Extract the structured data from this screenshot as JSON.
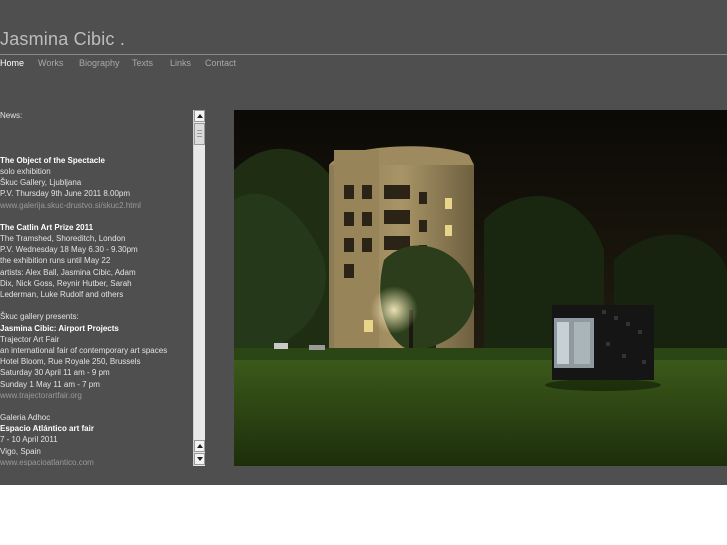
{
  "site": {
    "title": "Jasmina Cibic ."
  },
  "nav": {
    "items": [
      "Home",
      "Works",
      "Biography",
      "Texts",
      "Links",
      "Contact"
    ],
    "active": "Home"
  },
  "news": {
    "heading": "News:",
    "entries": [
      {
        "title": "The Object of the Spectacle",
        "lines": [
          "solo exhibition",
          "Škuc Gallery, Ljubljana",
          "P.V. Thursday 9th June 2011 8.00pm"
        ],
        "link": "www.galerija.skuc-drustvo.si/skuc2.html"
      },
      {
        "title": "The Catlin Art Prize 2011",
        "lines": [
          "The Tramshed, Shoreditch, London",
          "P.V. Wednesday 18 May 6.30 - 9.30pm",
          "the exhibition runs until May 22",
          "artists: Alex Ball, Jasmina Cibic, Adam",
          "Dix, Nick Goss, Reynir Hutber, Sarah",
          "Lederman, Luke Rudolf and others"
        ]
      },
      {
        "intro": "Škuc gallery presents:",
        "title": "Jasmina Cibic: Airport Projects",
        "lines": [
          "Trajector Art Fair",
          "an international fair of contemporary art spaces",
          "Hotel Bloom, Rue Royale 250, Brussels",
          "Saturday 30 April 11 am - 9 pm",
          "Sunday 1 May 11 am - 7 pm"
        ],
        "link": "www.trajectorartfair.org"
      },
      {
        "intro": "Galeria Adhoc",
        "title": "Espacio Atlántico art fair",
        "lines": [
          "7 - 10 April 2011",
          "Vigo, Spain"
        ],
        "link": "www.espacioatlantico.com"
      }
    ]
  },
  "colors": {
    "background": "#4f4f4f",
    "nav_active": "#ffffff",
    "nav_inactive": "#a8a8a8",
    "link": "#9a9a9a"
  }
}
